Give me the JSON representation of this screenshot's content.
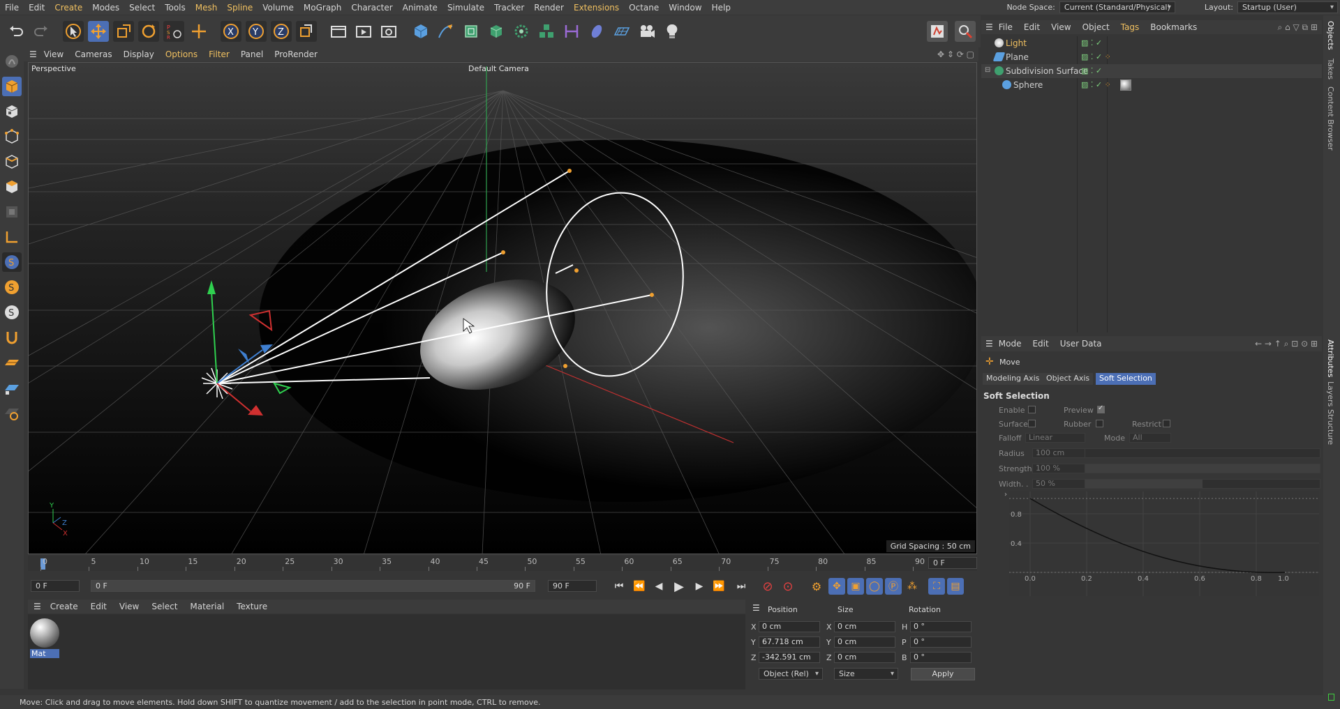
{
  "menubar": {
    "items": [
      "File",
      "Edit",
      "Create",
      "Modes",
      "Select",
      "Tools",
      "Mesh",
      "Spline",
      "Volume",
      "MoGraph",
      "Character",
      "Animate",
      "Simulate",
      "Tracker",
      "Render",
      "Extensions",
      "Octane",
      "Window",
      "Help"
    ],
    "node_space_label": "Node Space:",
    "node_space_value": "Current (Standard/Physical)",
    "layout_label": "Layout:",
    "layout_value": "Startup (User)"
  },
  "viewport": {
    "menu": [
      "View",
      "Cameras",
      "Display",
      "Options",
      "Filter",
      "Panel",
      "ProRender"
    ],
    "projection": "Perspective",
    "camera": "Default Camera",
    "grid_spacing": "Grid Spacing : 50 cm"
  },
  "timeline": {
    "ticks": [
      "0",
      "5",
      "10",
      "15",
      "20",
      "25",
      "30",
      "35",
      "40",
      "45",
      "50",
      "55",
      "60",
      "65",
      "70",
      "75",
      "80",
      "85",
      "90"
    ],
    "current_frame": "0 F",
    "start_field": "0 F",
    "range_start": "0 F",
    "range_end": "90 F",
    "end_field": "90 F"
  },
  "material_manager": {
    "menu": [
      "Create",
      "Edit",
      "View",
      "Select",
      "Material",
      "Texture"
    ],
    "material_name": "Mat"
  },
  "coordinates": {
    "headers": [
      "Position",
      "Size",
      "Rotation"
    ],
    "rows": [
      {
        "axis": "X",
        "position": "0 cm",
        "size_axis": "X",
        "size": "0 cm",
        "rot_axis": "H",
        "rotation": "0 °"
      },
      {
        "axis": "Y",
        "position": "67.718 cm",
        "size_axis": "Y",
        "size": "0 cm",
        "rot_axis": "P",
        "rotation": "0 °"
      },
      {
        "axis": "Z",
        "position": "-342.591 cm",
        "size_axis": "Z",
        "size": "0 cm",
        "rot_axis": "B",
        "rotation": "0 °"
      }
    ],
    "mode_combo": "Object (Rel)",
    "size_combo": "Size",
    "apply_label": "Apply"
  },
  "object_manager": {
    "menu": [
      "File",
      "Edit",
      "View",
      "Object",
      "Tags",
      "Bookmarks"
    ],
    "objects": [
      {
        "name": "Light",
        "color": "#f0c060"
      },
      {
        "name": "Plane",
        "color": "#cfcfcf"
      },
      {
        "name": "Subdivision Surface",
        "color": "#cfcfcf"
      },
      {
        "name": "Sphere",
        "color": "#cfcfcf"
      }
    ]
  },
  "attribute_manager": {
    "menu": [
      "Mode",
      "Edit",
      "User Data"
    ],
    "tool_name": "Move",
    "tabs": [
      "Modeling Axis",
      "Object Axis",
      "Soft Selection"
    ],
    "section_title": "Soft Selection",
    "enable_label": "Enable",
    "preview_label": "Preview",
    "surface_label": "Surface",
    "rubber_label": "Rubber",
    "restrict_label": "Restrict",
    "falloff_label": "Falloff",
    "falloff_value": "Linear",
    "mode_label": "Mode",
    "mode_value": "All",
    "radius_label": "Radius",
    "radius_value": "100 cm",
    "strength_label": "Strength",
    "strength_value": "100 %",
    "width_label": "Width. .",
    "width_value": "50 %",
    "width_fraction": 0.5,
    "strength_fraction": 1.0,
    "curve_y_ticks": [
      "0.8",
      "0.4"
    ],
    "curve_x_ticks": [
      "0.0",
      "0.2",
      "0.4",
      "0.6",
      "0.8",
      "1.0"
    ]
  },
  "side_tabs": [
    "Objects",
    "Takes",
    "Content Browser",
    "Attributes",
    "Layers",
    "Structure"
  ],
  "status": "Move: Click and drag to move elements. Hold down SHIFT to quantize movement / add to the selection in point mode, CTRL to remove."
}
